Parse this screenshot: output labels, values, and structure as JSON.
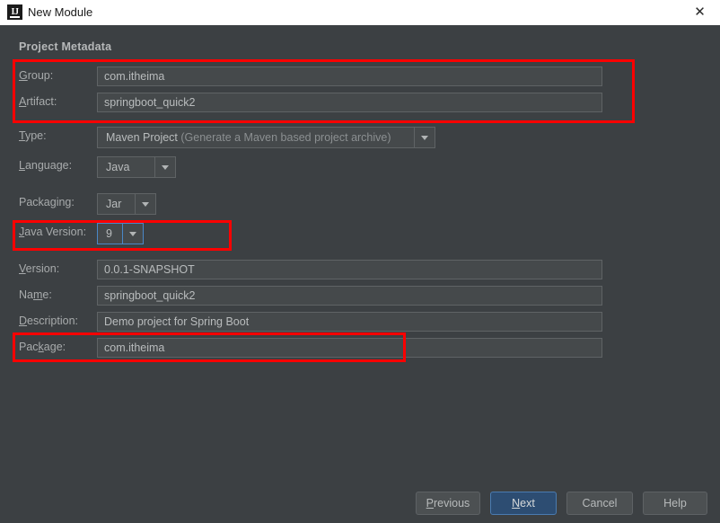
{
  "window": {
    "title": "New Module",
    "app_icon": "intellij-idea-icon",
    "close_icon": "close-icon"
  },
  "section": {
    "title": "Project Metadata"
  },
  "fields": {
    "group": {
      "label": "Group:",
      "mnemonic": "G",
      "value": "com.itheima"
    },
    "artifact": {
      "label": "Artifact:",
      "mnemonic": "A",
      "value": "springboot_quick2"
    },
    "type": {
      "label": "Type:",
      "mnemonic": "T",
      "value": "Maven Project",
      "value_detail": " (Generate a Maven based project archive)"
    },
    "language": {
      "label": "Language:",
      "mnemonic": "L",
      "value": "Java"
    },
    "packaging": {
      "label": "Packaging:",
      "mnemonic": "g",
      "value": "Jar"
    },
    "java_version": {
      "label": "Java Version:",
      "mnemonic": "J",
      "value": "9",
      "focused": true
    },
    "version": {
      "label": "Version:",
      "mnemonic": "V",
      "value": "0.0.1-SNAPSHOT"
    },
    "name": {
      "label": "Name:",
      "mnemonic": "m",
      "value": "springboot_quick2"
    },
    "description": {
      "label": "Description:",
      "mnemonic": "D",
      "value": "Demo project for Spring Boot"
    },
    "package": {
      "label": "Package:",
      "mnemonic": "k",
      "value": "com.itheima"
    }
  },
  "buttons": {
    "previous": "Previous",
    "next": "Next",
    "cancel": "Cancel",
    "help": "Help"
  },
  "annotations": {
    "accent_color": "#fe0000",
    "boxes": [
      "group-artifact-highlight",
      "java-version-highlight",
      "package-highlight"
    ]
  },
  "colors": {
    "dialog_background": "#3c4043",
    "field_background": "#45494b",
    "titlebar_background": "#ffffff",
    "focus_border": "#4a87c7",
    "default_button": "#2d4d72",
    "annotation_red": "#fe0000"
  }
}
